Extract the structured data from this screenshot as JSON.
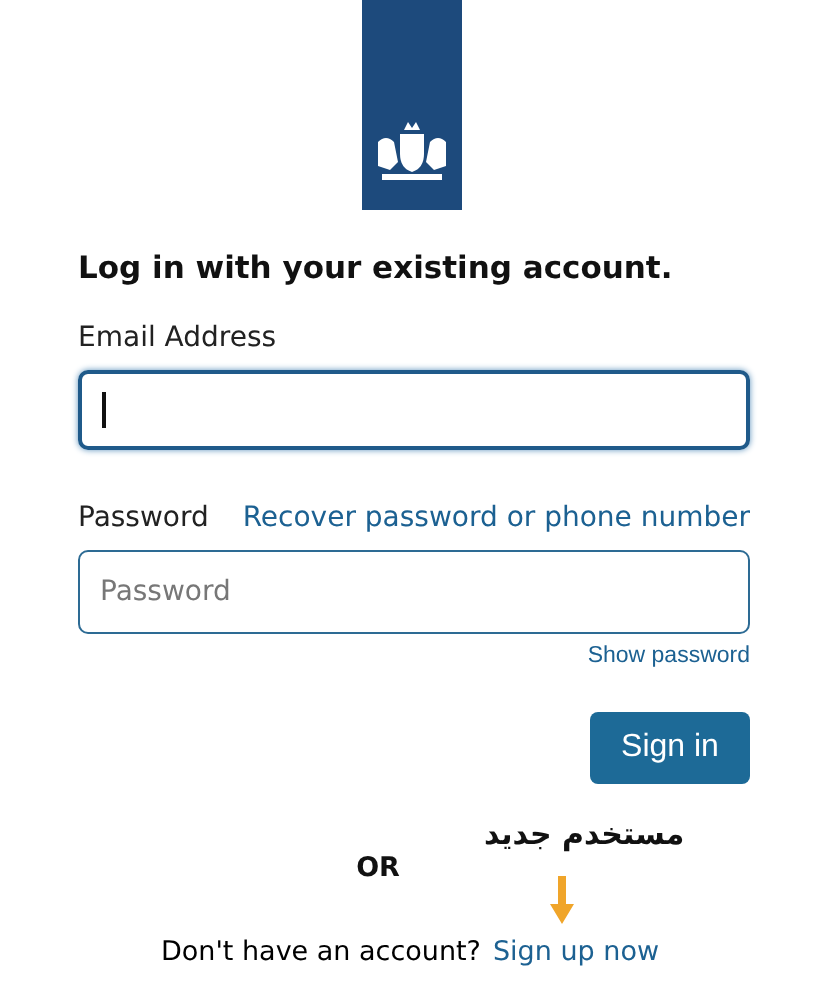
{
  "heading": "Log in with your existing account.",
  "email": {
    "label": "Email Address",
    "focused": true
  },
  "password": {
    "label": "Password",
    "recover_link": "Recover password or phone number",
    "placeholder": "Password",
    "show_link": "Show password"
  },
  "sign_in": "Sign in",
  "separator": "OR",
  "signup": {
    "question": "Don't have an account?",
    "link": "Sign up now"
  },
  "annotation": {
    "text": "مستخدم جديد"
  }
}
